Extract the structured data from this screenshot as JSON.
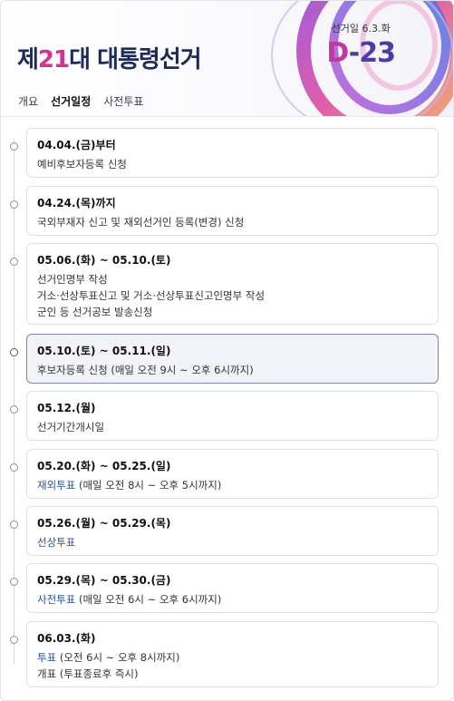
{
  "header": {
    "title_prefix": "제",
    "title_num": "21",
    "title_suffix": "대 대통령선거",
    "election_day_label": "선거일 6.3.화",
    "dday_d": "D",
    "dday_num": "-23"
  },
  "tabs": [
    {
      "label": "개요",
      "active": false
    },
    {
      "label": "선거일정",
      "active": true
    },
    {
      "label": "사전투표",
      "active": false
    }
  ],
  "schedule": [
    {
      "date": "04.04.(금)부터",
      "lines": [
        {
          "text": "예비후보자등록 신청"
        }
      ]
    },
    {
      "date": "04.24.(목)까지",
      "lines": [
        {
          "text": "국외부재자 신고 및 재외선거인 등록(변경) 신청"
        }
      ]
    },
    {
      "date": "05.06.(화) ~ 05.10.(토)",
      "lines": [
        {
          "text": "선거인명부 작성"
        },
        {
          "text": "거소·선상투표신고 및 거소·선상투표신고인명부 작성"
        },
        {
          "text": "군인 등 선거공보 발송신청"
        }
      ]
    },
    {
      "date": "05.10.(토) ~ 05.11.(일)",
      "active": true,
      "lines": [
        {
          "text": "후보자등록 신청 (매일 오전 9시 ~ 오후 6시까지)"
        }
      ]
    },
    {
      "date": "05.12.(월)",
      "lines": [
        {
          "text": "선거기간개시일"
        }
      ]
    },
    {
      "date": "05.20.(화) ~ 05.25.(일)",
      "lines": [
        {
          "link": "재외투표",
          "text": " (매일 오전 8시 ~ 오후 5시까지)"
        }
      ]
    },
    {
      "date": "05.26.(월) ~ 05.29.(목)",
      "lines": [
        {
          "link": "선상투표",
          "text": ""
        }
      ]
    },
    {
      "date": "05.29.(목) ~ 05.30.(금)",
      "lines": [
        {
          "link": "사전투표",
          "text": " (매일 오전 6시 ~ 오후 6시까지)"
        }
      ]
    },
    {
      "date": "06.03.(화)",
      "lines": [
        {
          "link": "투표",
          "text": " (오전 6시 ~ 오후 8시까지)"
        },
        {
          "text": "개표 (투표종료후 즉시)"
        }
      ]
    }
  ],
  "colors": {
    "accent": "#4e3aa8",
    "pink": "#d52f8f",
    "link": "#2c4fa8",
    "active_border": "#7c86b6"
  }
}
